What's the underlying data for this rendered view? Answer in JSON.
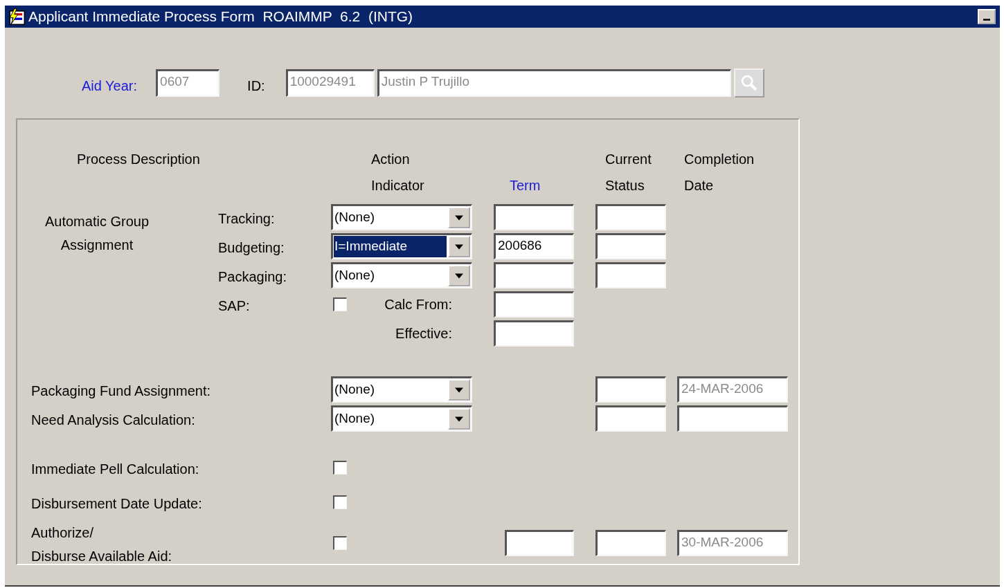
{
  "window": {
    "title": "Applicant Immediate Process Form  ROAIMMP  6.2  (INTG)"
  },
  "key_block": {
    "aid_year_label": "Aid Year:",
    "aid_year": {
      "value": "0607",
      "disabled": true
    },
    "id_label": "ID:",
    "id": {
      "value": "100029491",
      "disabled": true
    },
    "name": {
      "value": "Justin P Trujillo",
      "disabled": true
    }
  },
  "headings": [
    {
      "lines": [
        "Process Description"
      ],
      "link": false
    },
    {
      "lines": [
        "Action",
        "Indicator"
      ],
      "link": false
    },
    {
      "lines": [
        "Term"
      ],
      "link": true
    },
    {
      "lines": [
        "Current",
        "Status"
      ],
      "link": false
    },
    {
      "lines": [
        "Completion",
        "Date"
      ],
      "link": false
    }
  ],
  "group": {
    "label": "Automatic Group Assignment",
    "rows": [
      {
        "label": "Tracking:",
        "control": {
          "kind": "dropdown",
          "value": "(None)",
          "selected": false
        },
        "term": {},
        "status": {}
      },
      {
        "label": "Budgeting:",
        "control": {
          "kind": "dropdown",
          "value": "I=Immediate",
          "selected": true
        },
        "term": {
          "value": "200686"
        },
        "status": {}
      },
      {
        "label": "Packaging:",
        "control": {
          "kind": "dropdown",
          "value": "(None)",
          "selected": false
        },
        "term": {},
        "status": {}
      },
      {
        "label": "SAP:",
        "control": {
          "kind": "checkbox",
          "checked": false
        },
        "sublabel": "Calc From:",
        "term": {}
      },
      {
        "sublabel": "Effective:",
        "term": {}
      }
    ]
  },
  "rows": [
    {
      "label": "Packaging Fund Assignment:",
      "control": {
        "kind": "dropdown",
        "value": "(None)",
        "selected": false
      },
      "status": {},
      "completion": {
        "value": "24-MAR-2006",
        "disabled": true
      }
    },
    {
      "label": "Need Analysis Calculation:",
      "control": {
        "kind": "dropdown",
        "value": "(None)",
        "selected": false
      },
      "status": {},
      "completion": {}
    },
    {
      "label": "Immediate   Pell Calculation:",
      "control": {
        "kind": "checkbox",
        "checked": false
      }
    },
    {
      "label": "Disbursement Date Update:",
      "control": {
        "kind": "checkbox",
        "checked": false
      }
    },
    {
      "label": "Authorize/\nDisburse Available Aid:",
      "control": {
        "kind": "checkbox",
        "checked": false
      },
      "term": {},
      "status": {},
      "completion": {
        "value": "30-MAR-2006",
        "disabled": true
      }
    }
  ]
}
